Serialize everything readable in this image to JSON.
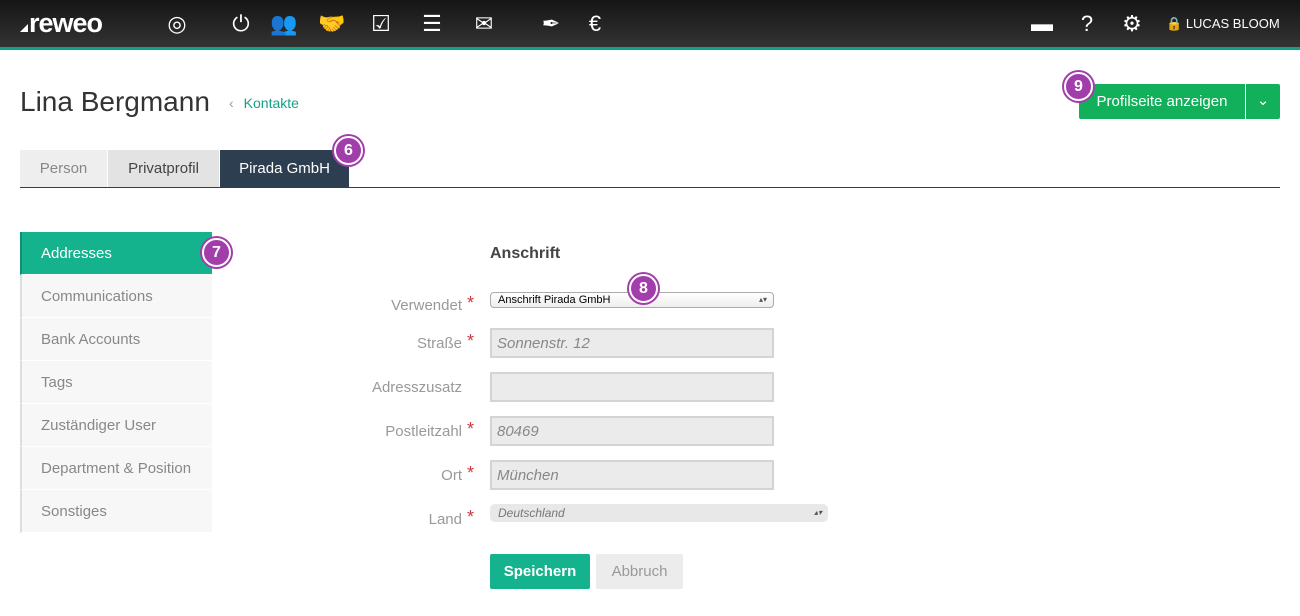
{
  "topbar": {
    "logo": "reweo",
    "user": "LUCAS BLOOM",
    "icons": [
      "dashboard-icon",
      "power-icon",
      "contacts-icon",
      "handshake-icon",
      "checkbox-icon",
      "list-icon",
      "mail-icon",
      "pen-icon",
      "euro-icon",
      "folder-icon",
      "help-icon",
      "gear-icon",
      "lock-icon"
    ]
  },
  "header": {
    "title": "Lina Bergmann",
    "breadcrumb": "Kontakte",
    "profile_button": "Profilseite anzeigen"
  },
  "tabs": [
    {
      "label": "Person"
    },
    {
      "label": "Privatprofil"
    },
    {
      "label": "Pirada GmbH",
      "active": true
    }
  ],
  "sidebar": {
    "items": [
      {
        "label": "Addresses",
        "active": true
      },
      {
        "label": "Communications"
      },
      {
        "label": "Bank Accounts"
      },
      {
        "label": "Tags"
      },
      {
        "label": "Zuständiger User"
      },
      {
        "label": "Department & Position"
      },
      {
        "label": "Sonstiges"
      }
    ]
  },
  "form": {
    "section": "Anschrift",
    "fields": {
      "verwendet": {
        "label": "Verwendet",
        "value": "Anschrift Pirada GmbH"
      },
      "strasse": {
        "label": "Straße",
        "placeholder": "Sonnenstr. 12"
      },
      "zusatz": {
        "label": "Adresszusatz",
        "placeholder": ""
      },
      "plz": {
        "label": "Postleitzahl",
        "placeholder": "80469"
      },
      "ort": {
        "label": "Ort",
        "placeholder": "München"
      },
      "land": {
        "label": "Land",
        "value": "Deutschland"
      }
    },
    "required_mark": "*",
    "save": "Speichern",
    "cancel": "Abbruch"
  },
  "badges": [
    "6",
    "7",
    "8",
    "9"
  ],
  "colors": {
    "accent": "#14b38e",
    "primary_button": "#13b05b",
    "badge": "#a23eab",
    "active_tab": "#2c3e50"
  }
}
